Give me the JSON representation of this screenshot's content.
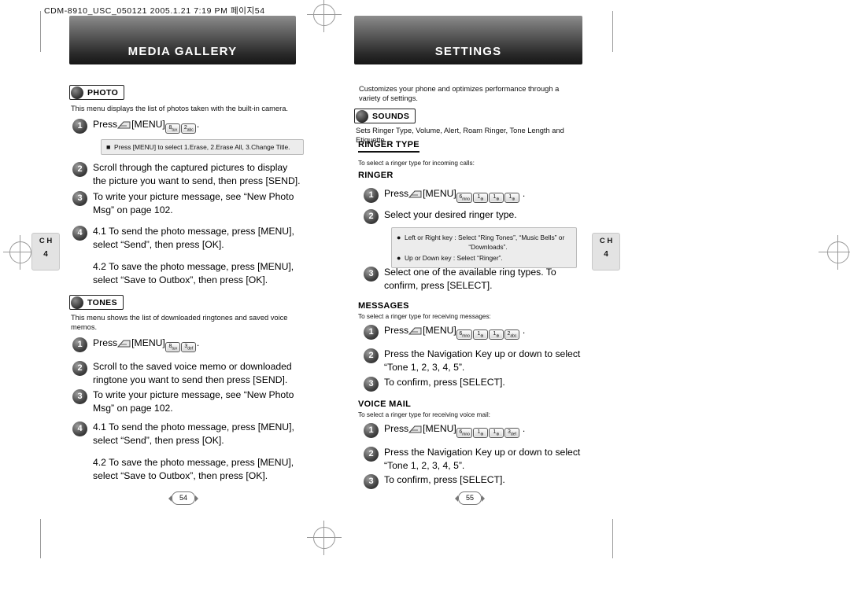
{
  "meta": {
    "header_line": "CDM-8910_USC_050121  2005.1.21 7:19 PM  페이지54"
  },
  "left_page": {
    "banner_title": "MEDIA GALLERY",
    "chapter_tab": {
      "label": "C H",
      "number": "4"
    },
    "page_number": "54",
    "photo_section": {
      "pill_label": "PHOTO",
      "description": "This menu displays the list of photos taken with the built-in camera.",
      "steps": [
        {
          "n": "1",
          "text": "Press",
          "keys": "[MENU] 8 2",
          "after": "."
        },
        {
          "n": "2",
          "text": "Scroll through the captured pictures to display the picture you want to send, then press [SEND]."
        },
        {
          "n": "3",
          "text": "To write your picture message, see “New Photo Msg” on page 102."
        },
        {
          "n": "4",
          "text": "4.1 To send the photo message, press [MENU], select “Send”, then press [OK].",
          "text2": "4.2 To save the photo message, press [MENU], select “Save to Outbox”, then press [OK]."
        }
      ],
      "note": "Press  [MENU] to select 1.Erase, 2.Erase All, 3.Change Title."
    },
    "tones_section": {
      "pill_label": "TONES",
      "description": "This menu shows the list of downloaded ringtones and saved voice memos.",
      "steps": [
        {
          "n": "1",
          "text": "Press",
          "keys": "[MENU] 8 3",
          "after": "."
        },
        {
          "n": "2",
          "text": "Scroll to the saved voice memo or downloaded ringtone you want to send then press [SEND]."
        },
        {
          "n": "3",
          "text": "To write your picture message, see “New Photo Msg” on page 102."
        },
        {
          "n": "4",
          "text": "4.1 To send the photo message, press [MENU], select “Send”, then press [OK].",
          "text2": "4.2 To save the photo message, press [MENU], select “Save to Outbox”, then press [OK]."
        }
      ]
    }
  },
  "right_page": {
    "banner_title": "SETTINGS",
    "chapter_tab": {
      "label": "C H",
      "number": "4"
    },
    "page_number": "55",
    "intro": "Customizes your phone and optimizes performance through a variety of settings.",
    "sounds_section": {
      "pill_label": "SOUNDS",
      "description": "Sets Ringer Type, Volume, Alert, Roam Ringer, Tone Length and Etiquette."
    },
    "ringer_type": {
      "heading": "RINGER TYPE",
      "ringer": {
        "heading": "RINGER",
        "note": "To select a ringer type for incoming calls:",
        "steps": [
          {
            "n": "1",
            "text": "Press",
            "keys": "[MENU] 6 1 1 1",
            "after": "."
          },
          {
            "n": "2",
            "text": "Select your desired ringer type."
          },
          {
            "n": "3",
            "text": "Select one of the available ring types. To confirm, press [SELECT]."
          }
        ],
        "tipbox": [
          "Left or Right key : Select “Ring Tones”, “Music Bells” or",
          "“Downloads”.",
          "Up or Down key : Select “Ringer”."
        ]
      },
      "messages": {
        "heading": "MESSAGES",
        "note": "To select a ringer type for receiving messages:",
        "steps": [
          {
            "n": "1",
            "text": "Press",
            "keys": "[MENU] 6 1 1 2",
            "after": "."
          },
          {
            "n": "2",
            "text": "Press the Navigation Key up or down to select “Tone 1, 2, 3, 4, 5”."
          },
          {
            "n": "3",
            "text": "To confirm, press [SELECT]."
          }
        ]
      },
      "voice_mail": {
        "heading": "VOICE MAIL",
        "note": "To select a ringer type for receiving voice mail:",
        "steps": [
          {
            "n": "1",
            "text": "Press",
            "keys": "[MENU] 6 1 1 3",
            "after": "."
          },
          {
            "n": "2",
            "text": "Press the Navigation Key up or down to select “Tone 1, 2, 3, 4, 5”."
          },
          {
            "n": "3",
            "text": "To confirm, press [SELECT]."
          }
        ]
      }
    }
  },
  "labels": {
    "menu": "[MENU]",
    "send": "[SEND]",
    "ok": "[OK]",
    "select": "[SELECT]",
    "press": "Press",
    "to_confirm": "To confirm, press"
  }
}
